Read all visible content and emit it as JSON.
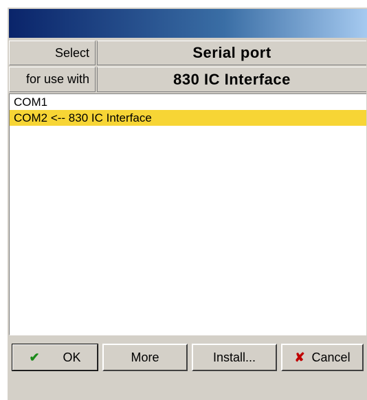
{
  "window": {
    "title": ""
  },
  "header": {
    "row1_label": "Select",
    "row1_value": "Serial port",
    "row2_label": "for use with",
    "row2_value": "830 IC Interface"
  },
  "ports": {
    "items": [
      {
        "label": "COM1",
        "selected": false
      },
      {
        "label": "COM2 <-- 830 IC Interface",
        "selected": true
      }
    ]
  },
  "buttons": {
    "ok": {
      "label": "OK",
      "icon": "checkmark-icon"
    },
    "more": {
      "label": "More"
    },
    "install": {
      "label": "Install..."
    },
    "cancel": {
      "label": "Cancel",
      "icon": "cross-icon"
    }
  },
  "colors": {
    "selection": "#f7d535",
    "face": "#d4d0c8",
    "title_gradient_start": "#0a246a",
    "title_gradient_end": "#a6caf0"
  }
}
